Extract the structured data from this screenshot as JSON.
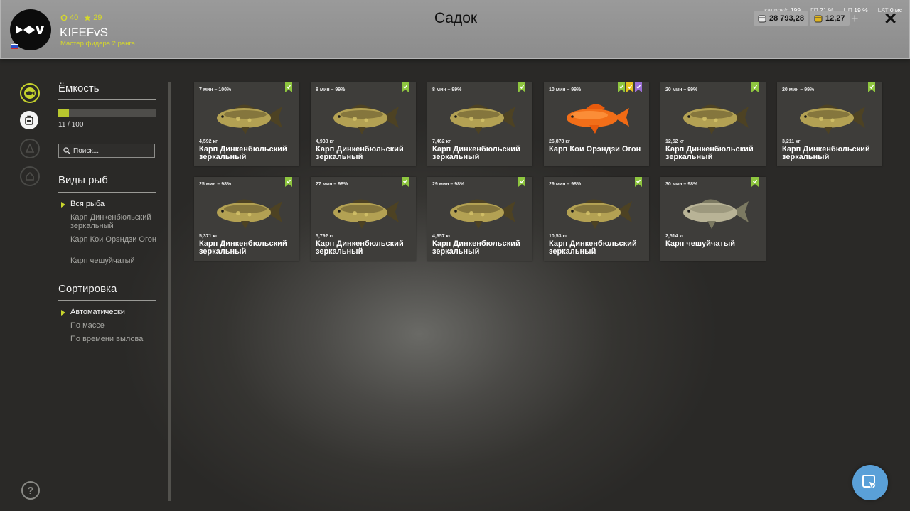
{
  "header": {
    "title": "Садок",
    "player": {
      "name": "KIFEFvS",
      "level": "40",
      "stars": "29",
      "rank": "Мастер фидера 2 ранга",
      "avatar_icon": "fish-logo-icon",
      "flag_icon": "russia-flag-icon"
    },
    "perf": {
      "fps_label": "кадров/с",
      "fps": "199",
      "gpu_label": "ГП",
      "gpu": "21 %",
      "cpu_label": "ЦП",
      "cpu": "19 %",
      "lat_label": "LAT",
      "lat": "0 мс"
    },
    "currency": {
      "silver": "28 793,28",
      "gold": "12,27"
    },
    "plus_label": "+",
    "close_label": "✕"
  },
  "sidebar": {
    "icons": [
      "keepnet-fish-icon",
      "backpack-icon",
      "boat-icon",
      "home-icon"
    ],
    "help_label": "?"
  },
  "filters": {
    "capacity_heading": "Ёмкость",
    "capacity_current": 11,
    "capacity_max": 100,
    "capacity_text": "11 / 100",
    "search_placeholder": "Поиск...",
    "species_heading": "Виды рыб",
    "species": [
      {
        "label": "Вся рыба",
        "selected": true
      },
      {
        "label": "Карп Динкенбюльский зеркальный",
        "selected": false
      },
      {
        "label": "Карп Кои Орэндзи Огон",
        "selected": false
      },
      {
        "label": "Карп чешуйчатый",
        "selected": false
      }
    ],
    "sort_heading": "Сортировка",
    "sort_options": [
      {
        "label": "Автоматически",
        "selected": true
      },
      {
        "label": "По массе",
        "selected": false
      },
      {
        "label": "По времени вылова",
        "selected": false
      }
    ]
  },
  "fish_cards": [
    {
      "time": "7 мин – 100%",
      "weight": "4,592 кг",
      "name": "Карп Динкенбюльский зеркальный",
      "type": "mirror",
      "badges": [
        "green"
      ]
    },
    {
      "time": "8 мин – 99%",
      "weight": "4,938 кг",
      "name": "Карп Динкенбюльский зеркальный",
      "type": "mirror",
      "badges": [
        "green"
      ]
    },
    {
      "time": "8 мин – 99%",
      "weight": "7,462 кг",
      "name": "Карп Динкенбюльский зеркальный",
      "type": "mirror",
      "badges": [
        "green"
      ]
    },
    {
      "time": "10 мин – 99%",
      "weight": "26,878 кг",
      "name": "Карп Кои Орэндзи Огон",
      "type": "koi",
      "badges": [
        "green",
        "yellow",
        "purple"
      ]
    },
    {
      "time": "20 мин – 99%",
      "weight": "12,52 кг",
      "name": "Карп Динкенбюльский зеркальный",
      "type": "mirror",
      "badges": [
        "green"
      ]
    },
    {
      "time": "20 мин – 99%",
      "weight": "3,211 кг",
      "name": "Карп Динкенбюльский зеркальный",
      "type": "mirror",
      "badges": [
        "green"
      ]
    },
    {
      "time": "25 мин – 98%",
      "weight": "5,371 кг",
      "name": "Карп Динкенбюльский зеркальный",
      "type": "mirror",
      "badges": [
        "green"
      ]
    },
    {
      "time": "27 мин – 98%",
      "weight": "5,792 кг",
      "name": "Карп Динкенбюльский зеркальный",
      "type": "mirror",
      "badges": [
        "green"
      ]
    },
    {
      "time": "29 мин – 98%",
      "weight": "4,957 кг",
      "name": "Карп Динкенбюльский зеркальный",
      "type": "mirror",
      "badges": [
        "green"
      ]
    },
    {
      "time": "29 мин – 98%",
      "weight": "10,53 кг",
      "name": "Карп Динкенбюльский зеркальный",
      "type": "mirror",
      "badges": [
        "green"
      ]
    },
    {
      "time": "30 мин – 98%",
      "weight": "2,514 кг",
      "name": "Карп чешуйчатый",
      "type": "common",
      "badges": [
        "green"
      ]
    }
  ],
  "colors": {
    "accent": "#c6d22c",
    "badge_green": "#8ec63f",
    "badge_yellow": "#e6c21e",
    "badge_purple": "#9b6fd6",
    "cursor_button": "#5aa0d8"
  },
  "cursor_button_icon": "cursor-select-icon"
}
